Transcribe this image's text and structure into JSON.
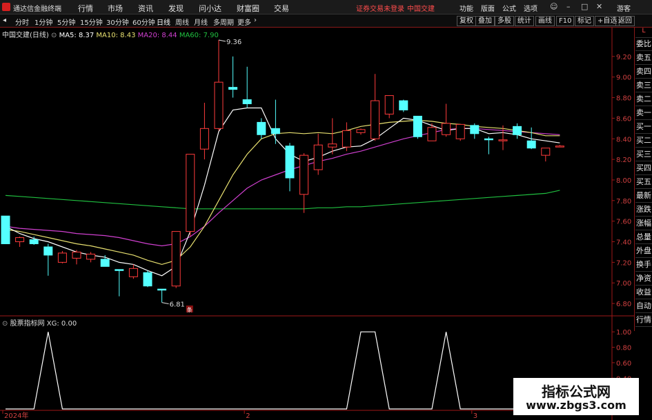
{
  "app": {
    "name": "通达信金融终端",
    "menu": [
      "行情",
      "市场",
      "资讯",
      "发现",
      "问小达",
      "财富圈",
      "交易"
    ],
    "status_red": [
      "证券交易未登录",
      "中国交建"
    ],
    "right_buttons": [
      "功能",
      "版面",
      "公式",
      "选项"
    ],
    "guest": "游客"
  },
  "toolbar": {
    "periods": [
      "分时",
      "1分钟",
      "5分钟",
      "15分钟",
      "30分钟",
      "60分钟",
      "日线",
      "周线",
      "月线",
      "多周期",
      "更多"
    ],
    "active_period": "日线",
    "right_buttons": [
      "复权",
      "叠加",
      "多股",
      "统计",
      "画线",
      "F10",
      "标记",
      "+自选",
      "返回"
    ]
  },
  "main_legend": {
    "stock": "中国交建(日线)",
    "ma5": "MA5: 8.37",
    "ma10": "MA10: 8.43",
    "ma20": "MA20: 8.44",
    "ma60": "MA60: 7.90"
  },
  "indicator_legend": {
    "name": "股票指标网",
    "value": "XG: 0.00"
  },
  "side_panel": [
    "委比",
    "卖五",
    "卖四",
    "卖三",
    "卖二",
    "卖一",
    "买一",
    "买二",
    "买三",
    "买四",
    "买五",
    "最新",
    "涨跌",
    "涨幅",
    "总量",
    "外盘",
    "换手",
    "净资",
    "收益",
    "自动",
    "行情"
  ],
  "watermark": {
    "line1": "指标公式网",
    "line2": "www.zbgs3.com"
  },
  "colors": {
    "up": "#ff3b3b",
    "down": "#54ffff",
    "ma5": "#ffffff",
    "ma10": "#e8e070",
    "ma20": "#d040d0",
    "ma60": "#20c040",
    "indicator": "#ffffff",
    "axis": "#a01818"
  },
  "chart_data": [
    {
      "type": "candlestick",
      "ylim": [
        6.7,
        9.4
      ],
      "y_ticks": [
        "9.20",
        "9.00",
        "8.80",
        "8.60",
        "8.40",
        "8.20",
        "8.00",
        "7.80",
        "7.60",
        "7.40",
        "7.20",
        "7.00",
        "6.80"
      ],
      "annotations": {
        "high": "9.36",
        "low": "6.81",
        "marker": "条"
      },
      "candles": [
        {
          "o": 7.65,
          "h": 7.65,
          "l": 7.38,
          "c": 7.38
        },
        {
          "o": 7.4,
          "h": 7.45,
          "l": 7.35,
          "c": 7.44
        },
        {
          "o": 7.42,
          "h": 7.45,
          "l": 7.37,
          "c": 7.38
        },
        {
          "o": 7.35,
          "h": 7.38,
          "l": 7.07,
          "c": 7.27
        },
        {
          "o": 7.2,
          "h": 7.31,
          "l": 7.19,
          "c": 7.29
        },
        {
          "o": 7.24,
          "h": 7.32,
          "l": 7.18,
          "c": 7.3
        },
        {
          "o": 7.23,
          "h": 7.3,
          "l": 7.2,
          "c": 7.28
        },
        {
          "o": 7.23,
          "h": 7.27,
          "l": 7.18,
          "c": 7.16
        },
        {
          "o": 7.13,
          "h": 7.13,
          "l": 6.87,
          "c": 7.12
        },
        {
          "o": 7.06,
          "h": 7.18,
          "l": 7.04,
          "c": 7.14
        },
        {
          "o": 7.1,
          "h": 7.12,
          "l": 6.96,
          "c": 6.97
        },
        {
          "o": 6.94,
          "h": 6.94,
          "l": 6.81,
          "c": 6.93
        },
        {
          "o": 6.97,
          "h": 7.5,
          "l": 6.95,
          "c": 7.5
        },
        {
          "o": 7.5,
          "h": 8.25,
          "l": 7.45,
          "c": 8.25
        },
        {
          "o": 8.3,
          "h": 8.75,
          "l": 8.2,
          "c": 8.5
        },
        {
          "o": 8.5,
          "h": 9.36,
          "l": 8.48,
          "c": 8.95
        },
        {
          "o": 8.9,
          "h": 9.2,
          "l": 8.8,
          "c": 8.88
        },
        {
          "o": 8.78,
          "h": 9.1,
          "l": 8.7,
          "c": 8.74
        },
        {
          "o": 8.56,
          "h": 8.6,
          "l": 8.4,
          "c": 8.44
        },
        {
          "o": 8.5,
          "h": 8.78,
          "l": 8.35,
          "c": 8.45
        },
        {
          "o": 8.33,
          "h": 8.36,
          "l": 7.89,
          "c": 8.02
        },
        {
          "o": 7.86,
          "h": 8.26,
          "l": 7.68,
          "c": 8.24
        },
        {
          "o": 8.1,
          "h": 8.45,
          "l": 8.05,
          "c": 8.34
        },
        {
          "o": 8.32,
          "h": 8.6,
          "l": 8.25,
          "c": 8.35
        },
        {
          "o": 8.32,
          "h": 8.56,
          "l": 8.28,
          "c": 8.48
        },
        {
          "o": 8.46,
          "h": 8.5,
          "l": 8.44,
          "c": 8.49
        },
        {
          "o": 8.4,
          "h": 9.03,
          "l": 8.38,
          "c": 8.77
        },
        {
          "o": 8.64,
          "h": 8.82,
          "l": 8.6,
          "c": 8.82
        },
        {
          "o": 8.77,
          "h": 8.78,
          "l": 8.66,
          "c": 8.68
        },
        {
          "o": 8.62,
          "h": 8.62,
          "l": 8.4,
          "c": 8.42
        },
        {
          "o": 8.38,
          "h": 8.55,
          "l": 8.38,
          "c": 8.51
        },
        {
          "o": 8.44,
          "h": 8.74,
          "l": 8.42,
          "c": 8.55
        },
        {
          "o": 8.4,
          "h": 8.54,
          "l": 8.38,
          "c": 8.54
        },
        {
          "o": 8.53,
          "h": 8.55,
          "l": 8.4,
          "c": 8.45
        },
        {
          "o": 8.4,
          "h": 8.42,
          "l": 8.25,
          "c": 8.39
        },
        {
          "o": 8.39,
          "h": 8.53,
          "l": 8.29,
          "c": 8.39
        },
        {
          "o": 8.52,
          "h": 8.55,
          "l": 8.4,
          "c": 8.44
        },
        {
          "o": 8.38,
          "h": 8.51,
          "l": 8.3,
          "c": 8.31
        },
        {
          "o": 8.24,
          "h": 8.31,
          "l": 8.18,
          "c": 8.31
        },
        {
          "o": 8.32,
          "h": 8.34,
          "l": 8.32,
          "c": 8.33
        }
      ],
      "ma5": [
        7.55,
        7.48,
        7.43,
        7.4,
        7.35,
        7.3,
        7.27,
        7.25,
        7.2,
        7.18,
        7.12,
        7.07,
        7.16,
        7.5,
        7.95,
        8.47,
        8.68,
        8.7,
        8.7,
        8.4,
        8.25,
        8.18,
        8.22,
        8.28,
        8.32,
        8.33,
        8.4,
        8.5,
        8.6,
        8.58,
        8.53,
        8.48,
        8.5,
        8.5,
        8.45,
        8.46,
        8.44,
        8.4,
        8.38,
        8.36
      ],
      "ma10": [
        7.52,
        7.5,
        7.47,
        7.44,
        7.41,
        7.38,
        7.36,
        7.33,
        7.3,
        7.27,
        7.22,
        7.18,
        7.22,
        7.35,
        7.55,
        7.8,
        8.05,
        8.25,
        8.4,
        8.45,
        8.46,
        8.45,
        8.46,
        8.45,
        8.48,
        8.52,
        8.54,
        8.56,
        8.57,
        8.58,
        8.57,
        8.55,
        8.54,
        8.52,
        8.51,
        8.5,
        8.48,
        8.46,
        8.43,
        8.43
      ],
      "ma20": [
        7.55,
        7.53,
        7.52,
        7.51,
        7.5,
        7.48,
        7.47,
        7.46,
        7.44,
        7.41,
        7.38,
        7.36,
        7.38,
        7.45,
        7.55,
        7.68,
        7.8,
        7.92,
        8.0,
        8.05,
        8.1,
        8.14,
        8.18,
        8.21,
        8.25,
        8.28,
        8.32,
        8.36,
        8.4,
        8.43,
        8.46,
        8.49,
        8.5,
        8.5,
        8.49,
        8.48,
        8.47,
        8.46,
        8.45,
        8.44
      ],
      "ma60": [
        7.85,
        7.84,
        7.83,
        7.82,
        7.81,
        7.8,
        7.79,
        7.78,
        7.77,
        7.76,
        7.75,
        7.74,
        7.73,
        7.72,
        7.72,
        7.72,
        7.72,
        7.72,
        7.72,
        7.72,
        7.72,
        7.72,
        7.73,
        7.73,
        7.74,
        7.74,
        7.75,
        7.76,
        7.77,
        7.78,
        7.79,
        7.8,
        7.81,
        7.82,
        7.83,
        7.84,
        7.85,
        7.86,
        7.87,
        7.9
      ]
    },
    {
      "type": "line",
      "name": "XG",
      "ylim": [
        0,
        1.1
      ],
      "y_ticks": [
        "1.00",
        "0.80",
        "0.60",
        "0.40",
        "0.20"
      ],
      "x_labels": [
        "2024年",
        "2",
        "3"
      ],
      "x_label_idx": [
        0,
        17,
        33
      ],
      "values": [
        0,
        0,
        0,
        1,
        0,
        0,
        0,
        0,
        0,
        0,
        0,
        0,
        0,
        0,
        0,
        0,
        0,
        0,
        0,
        0,
        0,
        0,
        0,
        0,
        0,
        1,
        1,
        0,
        0,
        0,
        0,
        1,
        0,
        0,
        0,
        0,
        0,
        0,
        0,
        0
      ]
    }
  ]
}
